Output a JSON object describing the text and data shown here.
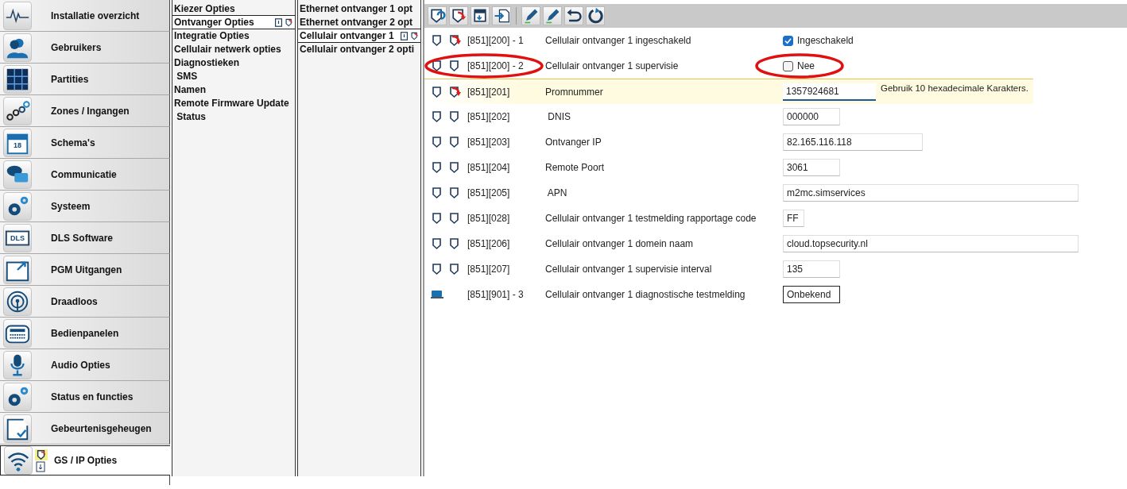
{
  "nav": [
    {
      "label": "Installatie overzicht",
      "selected": false
    },
    {
      "label": "Gebruikers",
      "selected": false
    },
    {
      "label": "Partities",
      "selected": false
    },
    {
      "label": "Zones / Ingangen",
      "selected": false
    },
    {
      "label": "Schema's",
      "icon_text": "18",
      "selected": false
    },
    {
      "label": "Communicatie",
      "selected": false
    },
    {
      "label": "Systeem",
      "selected": false
    },
    {
      "label": "DLS Software",
      "icon_text": "DLS",
      "selected": false
    },
    {
      "label": "PGM Uitgangen",
      "selected": false
    },
    {
      "label": "Draadloos",
      "selected": false
    },
    {
      "label": "Bedienpanelen",
      "selected": false
    },
    {
      "label": "Audio Opties",
      "selected": false
    },
    {
      "label": "Status en functies",
      "selected": false
    },
    {
      "label": "Gebeurtenisgeheugen",
      "selected": false
    },
    {
      "label": "GS / IP Opties",
      "selected": true
    }
  ],
  "sections": [
    {
      "label": "Kiezer Opties",
      "selected": false
    },
    {
      "label": "Ontvanger Opties",
      "selected": true
    },
    {
      "label": "Integratie Opties",
      "selected": false
    },
    {
      "label": "Cellulair netwerk opties",
      "selected": false
    },
    {
      "label": "Diagnostieken",
      "selected": false
    },
    {
      "label": " SMS",
      "selected": false
    },
    {
      "label": "Namen",
      "selected": false
    },
    {
      "label": "Remote Firmware Update",
      "selected": false
    },
    {
      "label": " Status",
      "selected": false
    }
  ],
  "receivers": [
    {
      "label": "Ethernet ontvanger 1 opt",
      "selected": false
    },
    {
      "label": "Ethernet ontvanger 2 opt",
      "selected": false
    },
    {
      "label": "Cellulair ontvanger 1",
      "selected": true
    },
    {
      "label": "Cellulair ontvanger 2 opti",
      "selected": false
    }
  ],
  "rows": [
    {
      "kind": "checkbox",
      "code": "[851][200] - 1",
      "label": "Cellulair ontvanger 1 ingeschakeld",
      "checked": true,
      "value": "Ingeschakeld",
      "modified": true,
      "selected": false,
      "circled": false
    },
    {
      "kind": "checkbox",
      "code": "[851][200] - 2",
      "label": "Cellulair ontvanger 1 supervisie",
      "checked": false,
      "value": "Nee",
      "modified": false,
      "selected": false,
      "circled": true
    },
    {
      "kind": "text",
      "code": "[851][201]",
      "label": "Promnummer",
      "value": "1357924681",
      "modified": true,
      "selected": true,
      "hint": "Gebruik 10 hexadecimale Karakters.",
      "circled": false
    },
    {
      "kind": "text",
      "code": "[851][202]",
      "label": " DNIS",
      "value": "000000",
      "modified": false,
      "selected": false,
      "circled": false
    },
    {
      "kind": "text",
      "code": "[851][203]",
      "label": "Ontvanger IP",
      "value": "82.165.116.118",
      "modified": false,
      "selected": false,
      "circled": false
    },
    {
      "kind": "text",
      "code": "[851][204]",
      "label": "Remote Poort",
      "value": "3061",
      "modified": false,
      "selected": false,
      "circled": false
    },
    {
      "kind": "text",
      "code": "[851][205]",
      "label": " APN",
      "value": "m2mc.simservices",
      "modified": false,
      "selected": false,
      "circled": false
    },
    {
      "kind": "text",
      "code": "[851][028]",
      "label": "Cellulair ontvanger 1 testmelding rapportage code",
      "value": "FF",
      "modified": false,
      "selected": false,
      "circled": false
    },
    {
      "kind": "text",
      "code": "[851][206]",
      "label": "Cellulair ontvanger 1 domein naam",
      "value": "cloud.topsecurity.nl",
      "modified": false,
      "selected": false,
      "circled": false
    },
    {
      "kind": "text",
      "code": "[851][207]",
      "label": "Cellulair ontvanger 1 supervisie interval",
      "value": "135",
      "modified": false,
      "selected": false,
      "circled": false
    },
    {
      "kind": "readonly",
      "code": "[851][901] - 3",
      "label": "Cellulair ontvanger 1 diagnostische testmelding",
      "value": "Onbekend",
      "selected": false,
      "circled": false
    }
  ]
}
